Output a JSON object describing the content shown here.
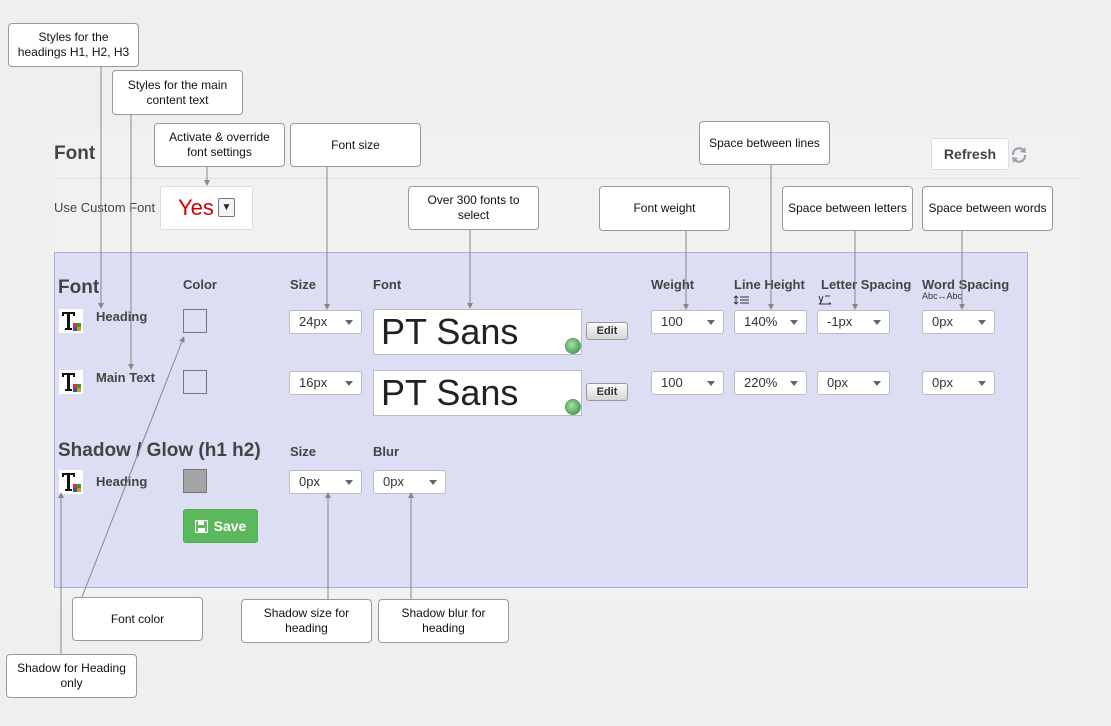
{
  "page": {
    "font_title": "Font",
    "refresh_label": "Refresh",
    "use_custom_font_label": "Use Custom Font",
    "use_custom_font_value": "Yes"
  },
  "panel": {
    "section_title": "Font",
    "columns": {
      "color": "Color",
      "size": "Size",
      "font": "Font",
      "weight": "Weight",
      "line_height": "Line Height",
      "letter_spacing": "Letter Spacing",
      "word_spacing": "Word Spacing",
      "word_spacing_hint": "Abc↔Abc"
    },
    "rows": [
      {
        "label": "Heading",
        "size": "24px",
        "font": "PT Sans",
        "edit": "Edit",
        "weight": "100",
        "line_height": "140%",
        "letter_spacing": "-1px",
        "word_spacing": "0px"
      },
      {
        "label": "Main Text",
        "size": "16px",
        "font": "PT Sans",
        "edit": "Edit",
        "weight": "100",
        "line_height": "220%",
        "letter_spacing": "0px",
        "word_spacing": "0px"
      }
    ],
    "shadow": {
      "title": "Shadow / Glow (h1 h2)",
      "size_label": "Size",
      "blur_label": "Blur",
      "row_label": "Heading",
      "size": "0px",
      "blur": "0px",
      "swatch_color": "#a4a4a4"
    },
    "save_label": "Save"
  },
  "callouts": {
    "headings": "Styles for the headings H1, H2, H3",
    "main_text": "Styles for the main content text",
    "activate": "Activate & override font settings",
    "font_size": "Font size",
    "fonts": "Over 300 fonts to select",
    "font_weight": "Font weight",
    "line_space": "Space between lines",
    "letter_space": "Space between letters",
    "word_space": "Space between words",
    "font_color": "Font color",
    "shadow_size": "Shadow size for heading",
    "shadow_blur": "Shadow blur for heading",
    "shadow_heading": "Shadow for Heading only"
  },
  "colors": {
    "panel_bg": "#dcdef3",
    "panel_border": "#a9acd5",
    "yes_text": "#d10000",
    "save_green": "#5cb85c"
  }
}
